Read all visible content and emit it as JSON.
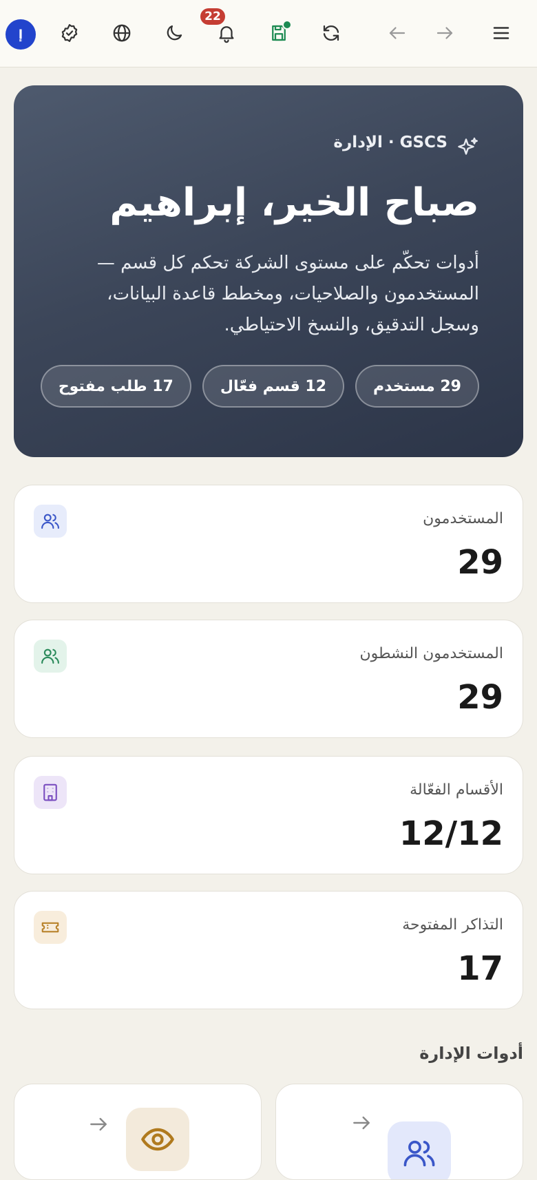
{
  "topbar": {
    "avatar_initials": "إ",
    "notification_count": "22",
    "icons": [
      "menu-icon",
      "forward-icon",
      "back-icon",
      "refresh-icon",
      "save-icon",
      "bell-icon",
      "moon-icon",
      "globe-icon",
      "check-badge-icon"
    ]
  },
  "hero": {
    "tag": "GSCS · الإدارة",
    "title": "صباح الخير، إبراهيم",
    "description": "أدوات تحكّم على مستوى الشركة تحكم كل قسم — المستخدمون والصلاحيات، ومخطط قاعدة البيانات، وسجل التدقيق، والنسخ الاحتياطي.",
    "chips": [
      "29 مستخدم",
      "12 قسم فعّال",
      "17 طلب مفتوح"
    ]
  },
  "stats": [
    {
      "label": "المستخدمون",
      "value": "29",
      "icon": "users-icon",
      "color": "#3a56c8",
      "bg": "#e7ecfb"
    },
    {
      "label": "المستخدمون النشطون",
      "value": "29",
      "icon": "users-icon",
      "color": "#2a8a5a",
      "bg": "#e3f3ea"
    },
    {
      "label": "الأقسام الفعّالة",
      "value": "12/12",
      "icon": "building-icon",
      "color": "#7b4fc0",
      "bg": "#ede5f8"
    },
    {
      "label": "التذاكر المفتوحة",
      "value": "17",
      "icon": "ticket-icon",
      "color": "#b8822a",
      "bg": "#f8eddc"
    }
  ],
  "section": {
    "title": "أدوات الإدارة"
  },
  "tools": [
    {
      "icon": "users-icon",
      "color": "#3a56c8",
      "bg": "#e3e8fb"
    },
    {
      "icon": "eye-icon",
      "color": "#b07a1e",
      "bg": "#f3eadb"
    }
  ]
}
